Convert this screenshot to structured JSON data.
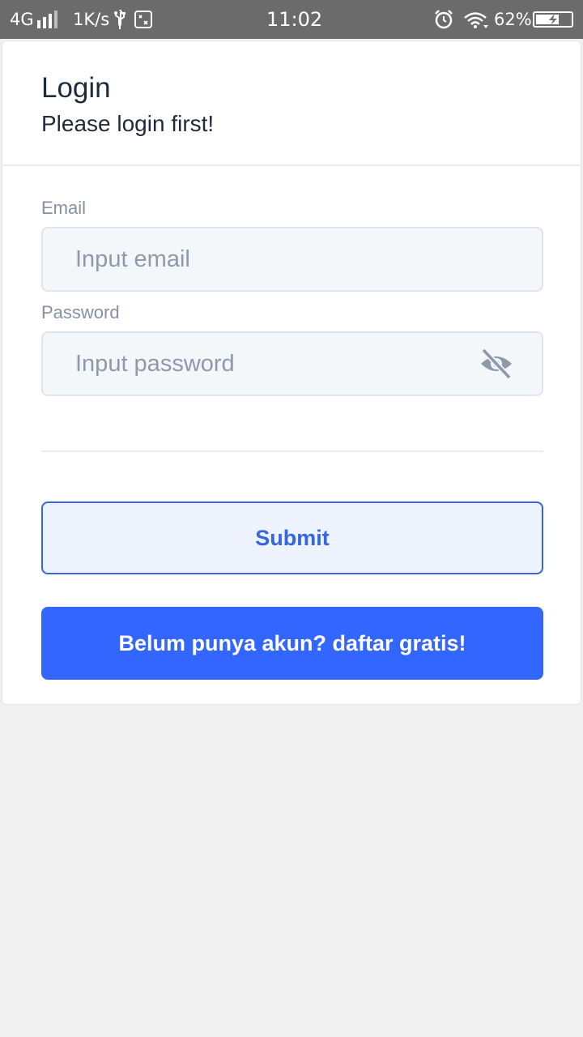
{
  "status_bar": {
    "network": "4G",
    "speed": "1K/s",
    "time": "11:02",
    "battery": "62%",
    "icons": [
      "signal-icon",
      "usb-icon",
      "notification-icon",
      "alarm-icon",
      "wifi-icon",
      "battery-icon"
    ]
  },
  "login": {
    "title": "Login",
    "subtitle": "Please login first!",
    "email": {
      "label": "Email",
      "value": "",
      "placeholder": "Input email"
    },
    "password": {
      "label": "Password",
      "value": "",
      "placeholder": "Input password",
      "toggle_icon": "eye-off-icon"
    },
    "submit_label": "Submit",
    "register_label": "Belum punya akun? daftar gratis!"
  },
  "colors": {
    "status_bar_bg": "#6b6b6b",
    "accent": "#3366ff",
    "submit_border": "#3366e0",
    "submit_bg": "#edf2fc",
    "page_bg": "#f0f0f0"
  }
}
